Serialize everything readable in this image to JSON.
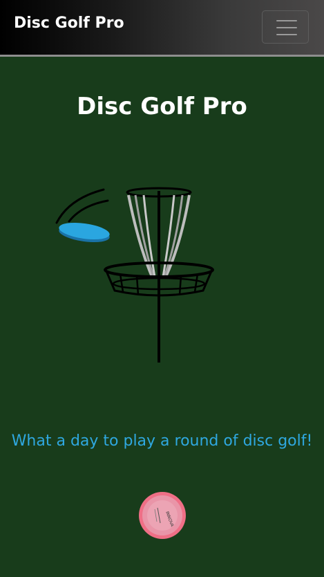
{
  "navbar": {
    "brand": "Disc Golf Pro",
    "menu_icon": "hamburger-icon"
  },
  "hero": {
    "title": "Disc Golf Pro",
    "illustration_icon": "disc-golf-basket-illustration",
    "tagline": "What a day to play a round of disc golf!"
  },
  "footer": {
    "disc_icon": "pink-disc-icon"
  },
  "colors": {
    "background": "#183c1b",
    "tagline": "#2fa8e0",
    "flying_disc": "#2aa6e0",
    "logo_disc": "#e77a90"
  }
}
